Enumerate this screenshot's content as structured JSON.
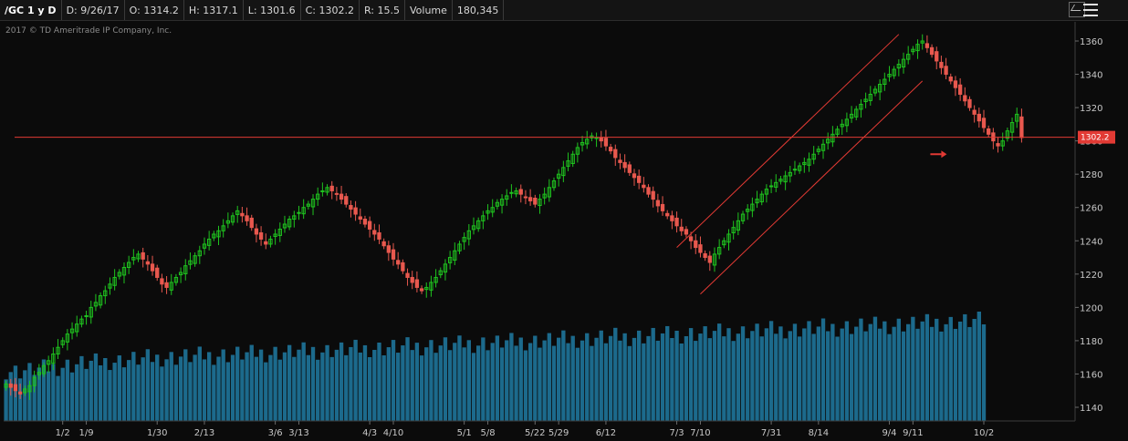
{
  "header": {
    "symbol": "/GC 1 y D",
    "date": "D: 9/26/17",
    "open": "O: 1314.2",
    "high": "H: 1317.1",
    "low": "L: 1301.6",
    "close": "C: 1302.2",
    "range": "R: 15.5",
    "volume_label": "Volume",
    "volume_value": "180,345"
  },
  "copyright": "2017 © TD Ameritrade IP Company, Inc.",
  "price_line_label": "1302.2",
  "colors": {
    "up": "#1fc31f",
    "down": "#e8584e",
    "volume": "#1c6a8c",
    "annotation": "#e23a34",
    "background": "#0b0b0b"
  },
  "chart_data": {
    "type": "candlestick",
    "ylim": [
      1130,
      1370
    ],
    "yticks": [
      1140,
      1160,
      1180,
      1200,
      1220,
      1240,
      1260,
      1280,
      1300,
      1320,
      1340,
      1360
    ],
    "xticks": [
      "1/2",
      "1/9",
      "1/30",
      "2/13",
      "3/6",
      "3/13",
      "4/3",
      "4/10",
      "5/1",
      "5/8",
      "5/22",
      "5/29",
      "6/12",
      "7/3",
      "7/10",
      "7/31",
      "8/14",
      "9/4",
      "9/11",
      "10/2"
    ],
    "xtick_index": [
      12,
      17,
      32,
      42,
      57,
      62,
      77,
      82,
      97,
      102,
      112,
      117,
      127,
      142,
      147,
      162,
      172,
      187,
      192,
      207
    ],
    "last_close": 1302.2,
    "channel_lines": [
      {
        "from": [
          142,
          1236
        ],
        "to": [
          189,
          1364
        ]
      },
      {
        "from": [
          147,
          1208
        ],
        "to": [
          194,
          1336
        ]
      }
    ],
    "arrow": {
      "index": 198,
      "value": 1292
    },
    "closes": [
      1154,
      1152,
      1150,
      1148,
      1151,
      1153,
      1158,
      1161,
      1165,
      1168,
      1172,
      1176,
      1180,
      1184,
      1187,
      1190,
      1193,
      1195,
      1200,
      1203,
      1207,
      1210,
      1214,
      1218,
      1221,
      1224,
      1227,
      1230,
      1232,
      1229,
      1226,
      1222,
      1218,
      1214,
      1212,
      1215,
      1218,
      1221,
      1225,
      1228,
      1231,
      1234,
      1238,
      1241,
      1244,
      1246,
      1249,
      1252,
      1255,
      1258,
      1255,
      1252,
      1248,
      1244,
      1241,
      1238,
      1241,
      1244,
      1247,
      1250,
      1253,
      1255,
      1257,
      1260,
      1262,
      1265,
      1268,
      1270,
      1272,
      1270,
      1268,
      1265,
      1262,
      1259,
      1256,
      1253,
      1250,
      1247,
      1244,
      1241,
      1237,
      1233,
      1229,
      1226,
      1222,
      1218,
      1215,
      1212,
      1210,
      1212,
      1215,
      1218,
      1222,
      1226,
      1230,
      1234,
      1238,
      1242,
      1246,
      1249,
      1252,
      1255,
      1258,
      1260,
      1263,
      1265,
      1267,
      1269,
      1270,
      1268,
      1266,
      1264,
      1262,
      1265,
      1268,
      1272,
      1276,
      1280,
      1284,
      1288,
      1292,
      1296,
      1299,
      1301,
      1303,
      1302,
      1300,
      1297,
      1294,
      1290,
      1287,
      1284,
      1281,
      1278,
      1275,
      1272,
      1268,
      1265,
      1261,
      1258,
      1255,
      1252,
      1249,
      1246,
      1244,
      1240,
      1236,
      1233,
      1230,
      1227,
      1232,
      1236,
      1240,
      1244,
      1248,
      1252,
      1256,
      1259,
      1262,
      1265,
      1268,
      1271,
      1273,
      1275,
      1277,
      1279,
      1281,
      1283,
      1285,
      1287,
      1289,
      1292,
      1295,
      1298,
      1301,
      1304,
      1307,
      1310,
      1313,
      1316,
      1319,
      1322,
      1325,
      1328,
      1331,
      1334,
      1337,
      1340,
      1343,
      1346,
      1349,
      1352,
      1355,
      1358,
      1360,
      1356,
      1352,
      1348,
      1344,
      1340,
      1336,
      1332,
      1328,
      1324,
      1320,
      1316,
      1312,
      1308,
      1304,
      1300,
      1297,
      1300,
      1306,
      1311,
      1316,
      1302
    ],
    "volumes": [
      6,
      6,
      5,
      5,
      6,
      6,
      7,
      7,
      8,
      9,
      9,
      10,
      11,
      12,
      12,
      13,
      14,
      14,
      15,
      15,
      16,
      16,
      17,
      17,
      17,
      18,
      18,
      19,
      19,
      19,
      20,
      20,
      20,
      21,
      21,
      21,
      21,
      22,
      22,
      22,
      22,
      23,
      23,
      23,
      23,
      24,
      24,
      24,
      24,
      25,
      25,
      25,
      25,
      26,
      26,
      26,
      26,
      27,
      27,
      27,
      27,
      28,
      28,
      28,
      28,
      29,
      29,
      29,
      29,
      30,
      30,
      30,
      30,
      31,
      31,
      31,
      31,
      32,
      32,
      32,
      32,
      33,
      33,
      33,
      33,
      34,
      34,
      34,
      34,
      35,
      35,
      35,
      35,
      36,
      36,
      36,
      36,
      37,
      37,
      37,
      37,
      38,
      38,
      38,
      38,
      39,
      39,
      39,
      39,
      40,
      40,
      40,
      40,
      41,
      41,
      41,
      41,
      42,
      42,
      42,
      42,
      43,
      43,
      43,
      43,
      44,
      44,
      44,
      44,
      45,
      45,
      45,
      45,
      46,
      46,
      46,
      46,
      47,
      47,
      47,
      47,
      48,
      48,
      48,
      48,
      49,
      49,
      49,
      49,
      50,
      50,
      50,
      50,
      51,
      51,
      51,
      51,
      52,
      52,
      52,
      52,
      53,
      53,
      53,
      53,
      54,
      54,
      54,
      54,
      55,
      55,
      55,
      55,
      56,
      56,
      56,
      56,
      57,
      57,
      57,
      57,
      58,
      58,
      58,
      58,
      59,
      59,
      59,
      59,
      60,
      60,
      60,
      60,
      61,
      61,
      61,
      61,
      62,
      62,
      62,
      62,
      63,
      63,
      63,
      63,
      64,
      64,
      64
    ]
  }
}
